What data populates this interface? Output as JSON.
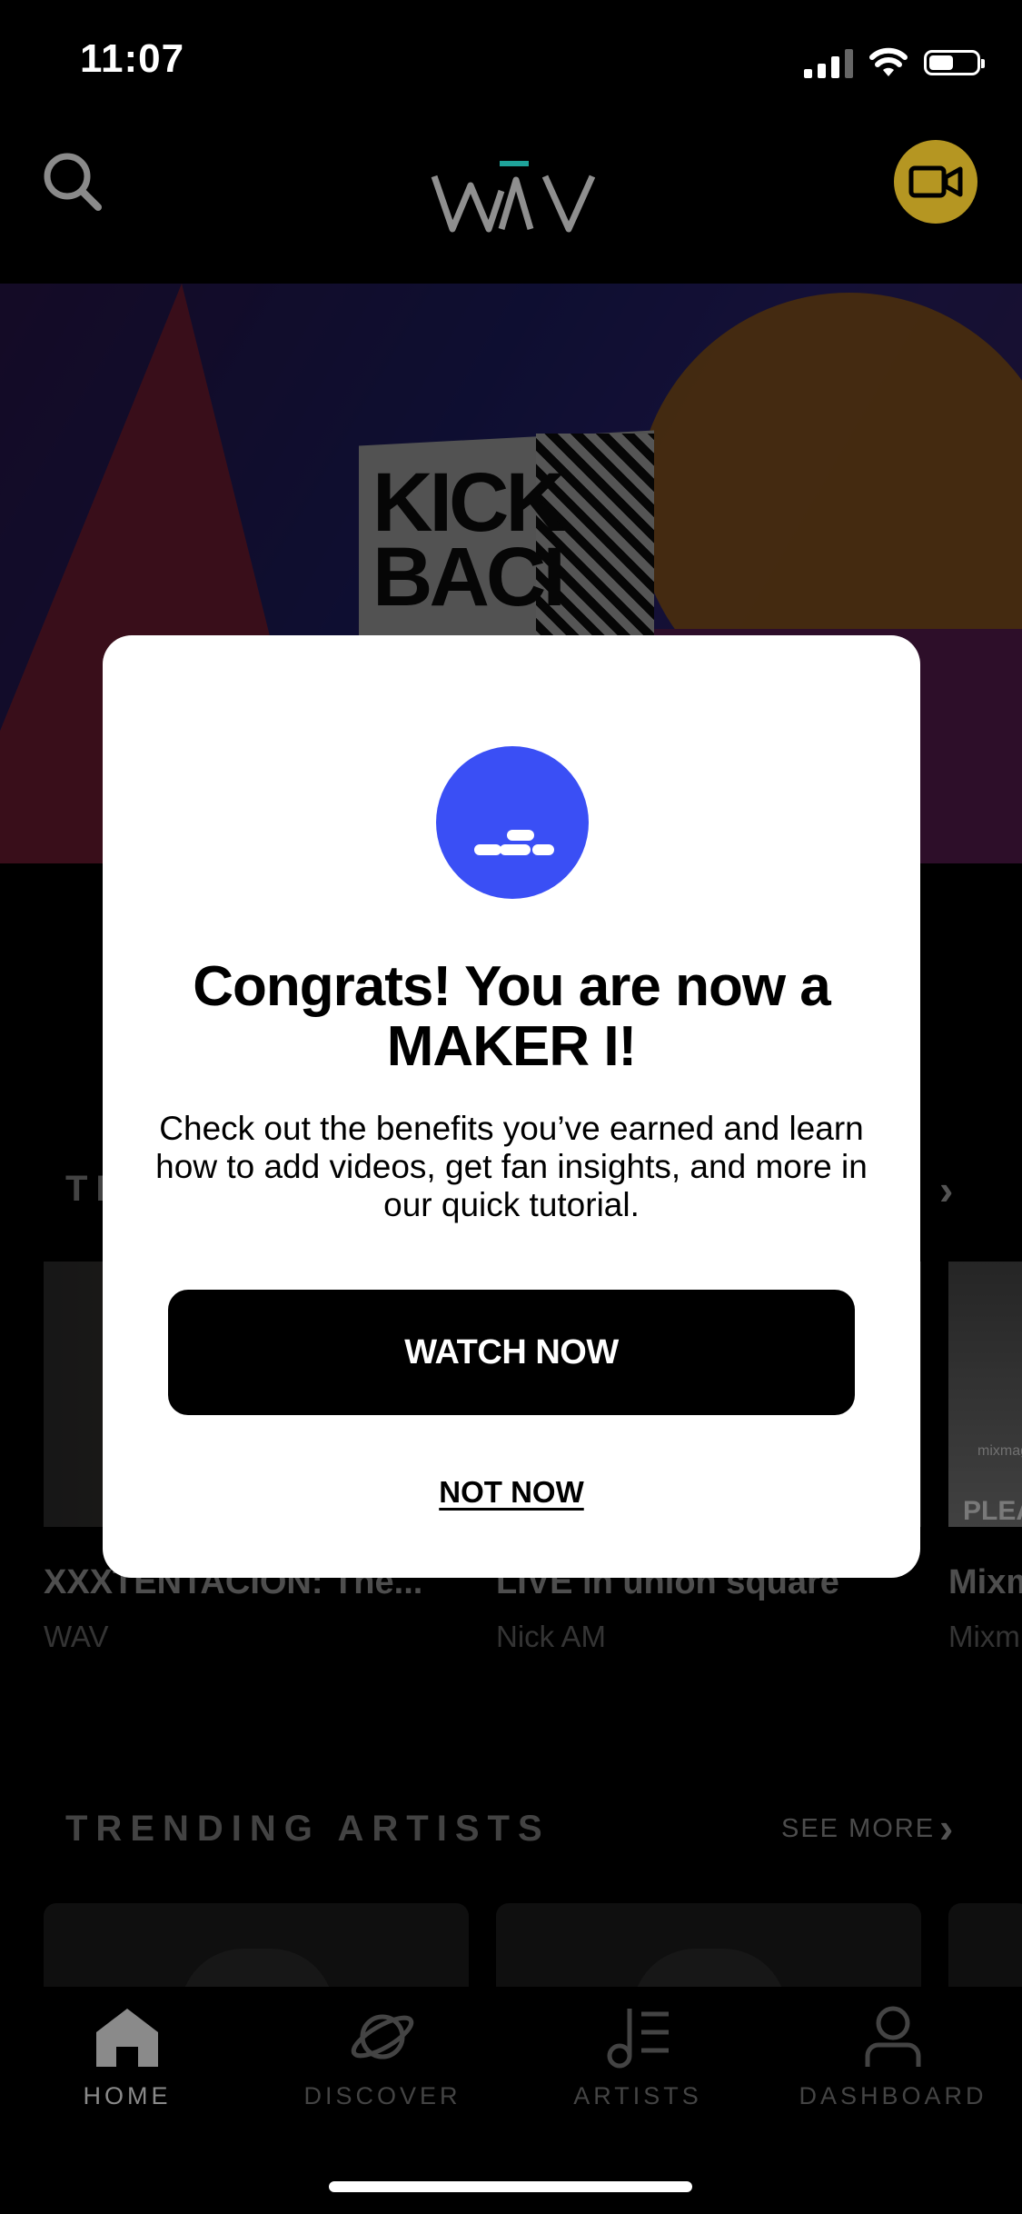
{
  "status_bar": {
    "time": "11:07"
  },
  "header": {
    "logo_text": "WAV"
  },
  "hero": {
    "art_text_line1": "KICK",
    "art_text_line2": "BACI"
  },
  "trending_videos": {
    "title_partial": "TR",
    "items": [
      {
        "title": "XXXTENTACION: The...",
        "subtitle": "WAV"
      },
      {
        "title": "LIVE in union square",
        "subtitle": "Nick AM"
      },
      {
        "title": "Mixm",
        "subtitle": "Mixm",
        "thumb_text_small": "mixmag",
        "thumb_text": "PLEA"
      }
    ]
  },
  "trending_artists": {
    "title": "TRENDING ARTISTS",
    "see_more": "SEE MORE"
  },
  "modal": {
    "title": "Congrats! You are now a MAKER I!",
    "body": "Check out the benefits you’ve earned and learn how to add videos, get fan insights, and more in our quick tutorial.",
    "primary_button": "WATCH NOW",
    "secondary_link": "NOT NOW"
  },
  "tabbar": {
    "items": [
      {
        "label": "HOME",
        "icon": "home-icon",
        "active": true
      },
      {
        "label": "DISCOVER",
        "icon": "planet-icon",
        "active": false
      },
      {
        "label": "ARTISTS",
        "icon": "music-note-list-icon",
        "active": false
      },
      {
        "label": "DASHBOARD",
        "icon": "person-icon",
        "active": false
      }
    ]
  },
  "colors": {
    "accent_badge": "#3a4ff5",
    "camera_button": "#b59622",
    "logo_accent": "#1fa39a"
  }
}
